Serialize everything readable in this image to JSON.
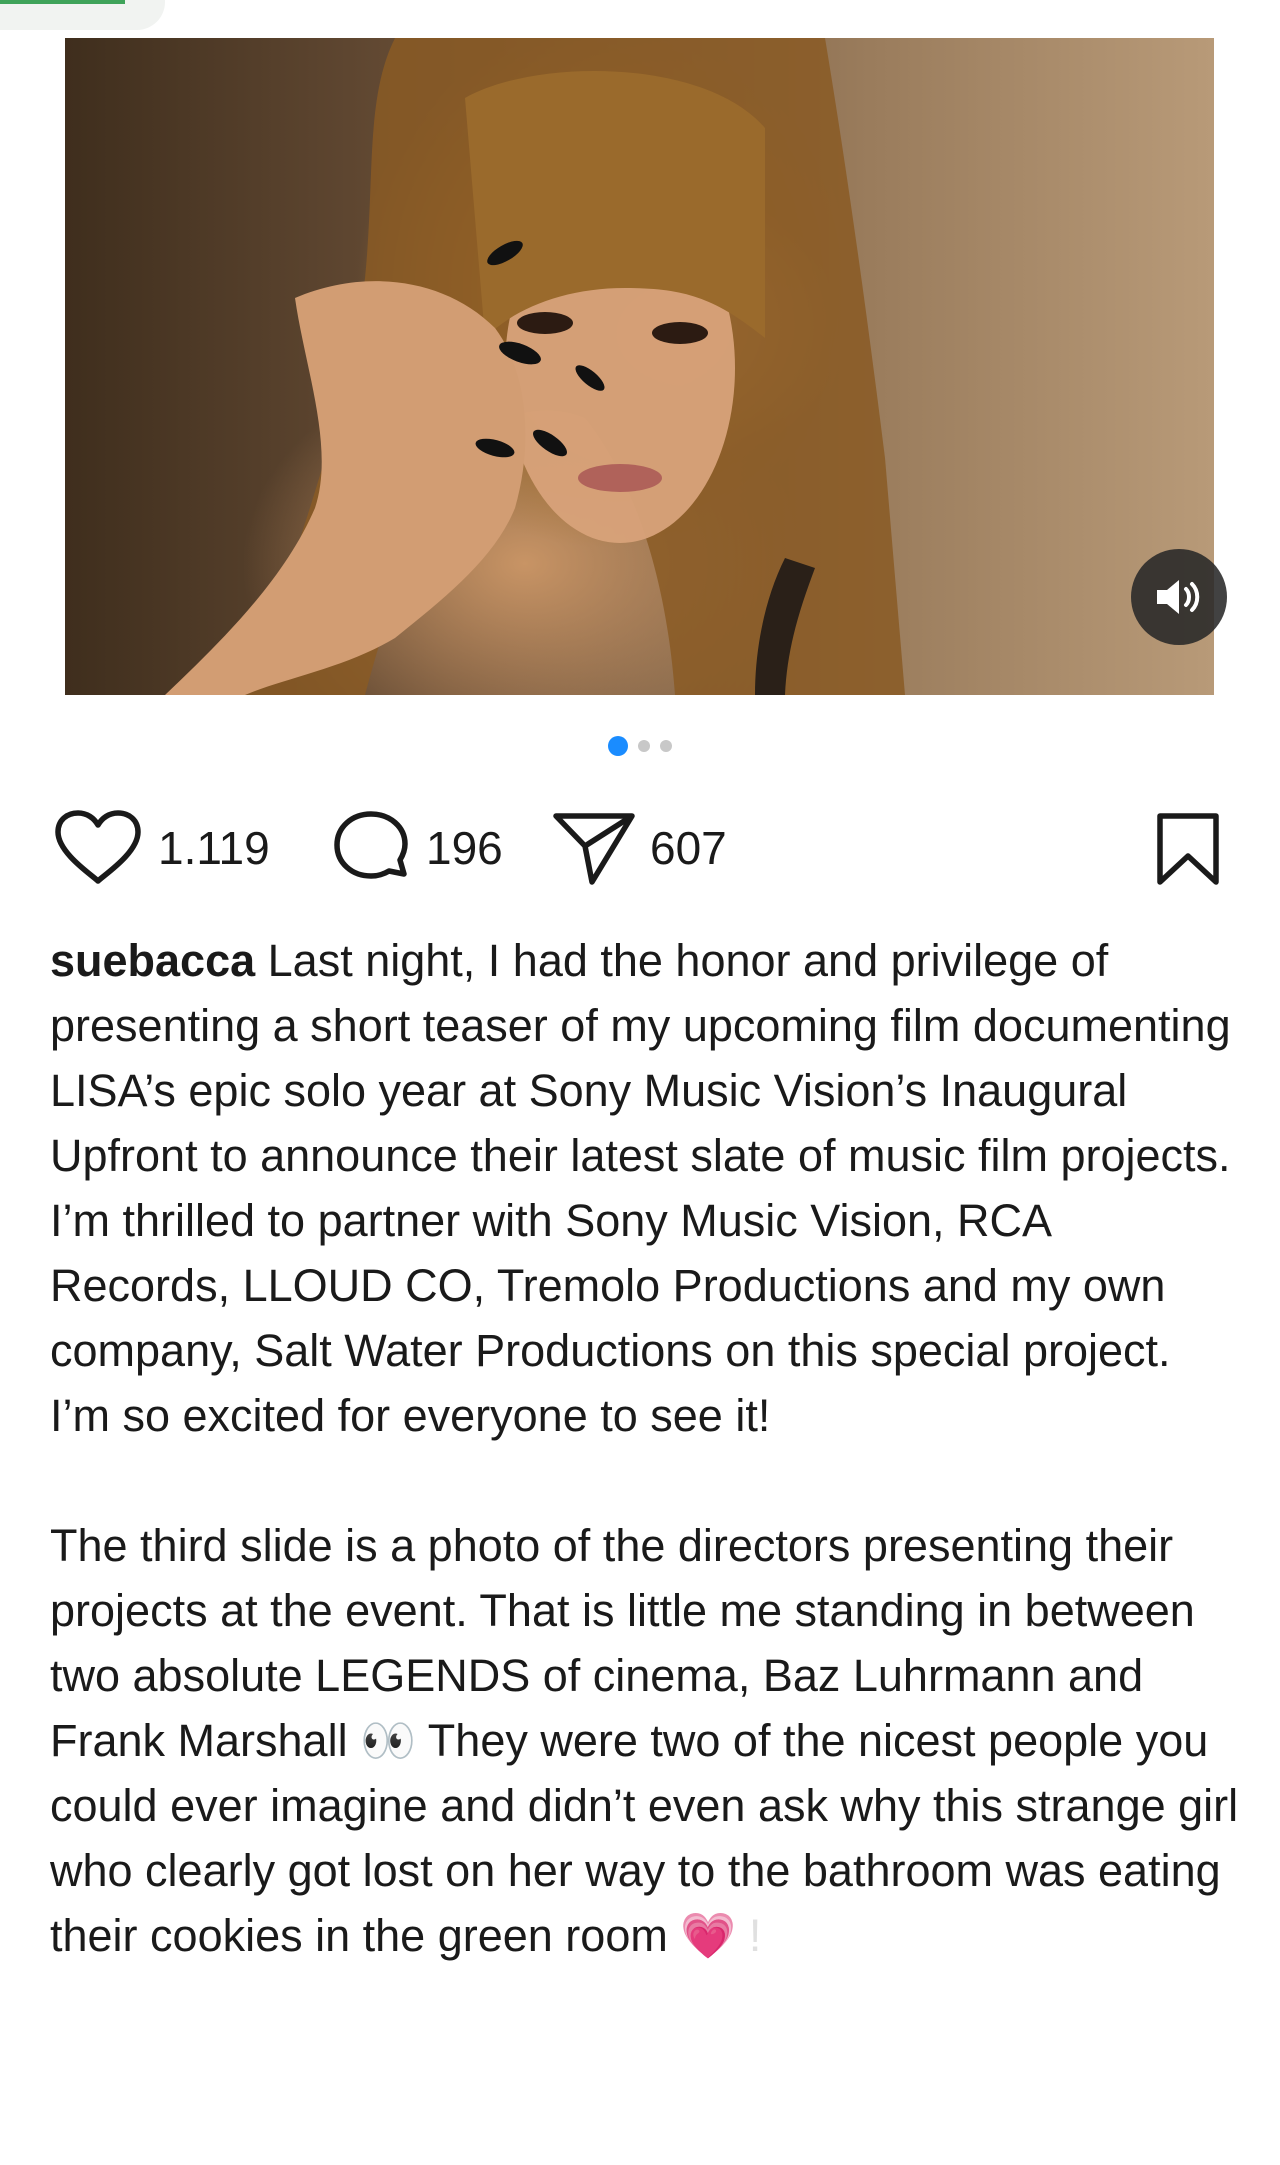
{
  "post": {
    "username": "suebacca",
    "caption_p1": " Last night, I had the honor and privilege of presenting a short teaser of my upcoming film documenting LISA’s epic solo year at Sony Music Vision’s Inaugural Upfront to announce their latest slate of music film projects. I’m thrilled to partner with Sony Music Vision, RCA Records, LLOUD CO, Tremolo Productions and my own company, Salt Water Productions on this special project. I’m so excited for everyone to see it!",
    "caption_p2_a": "The third slide is a photo of the directors presenting their projects at the event. That is little me standing in between two absolute LEGENDS of cinema, Baz Luhrmann and Frank Marshall ",
    "emoji_eyes": "👀",
    "caption_p2_b": " They were two of the nicest people you could ever imagine and didn’t even ask why this strange girl who clearly got lost on her way to the bathroom was eating their cookies in the green room ",
    "emoji_heart": "💗",
    "caption_faded": " !"
  },
  "stats": {
    "likes": "1.119",
    "comments": "196",
    "shares": "607"
  },
  "carousel": {
    "total": 3,
    "active_index": 0
  },
  "icons": {
    "like": "heart-icon",
    "comment": "comment-bubble-icon",
    "share": "send-icon",
    "save": "bookmark-icon",
    "sound": "speaker-icon"
  },
  "colors": {
    "accent": "#1a8cff",
    "text": "#1a1a1a",
    "dot_inactive": "#c8c8c8"
  }
}
